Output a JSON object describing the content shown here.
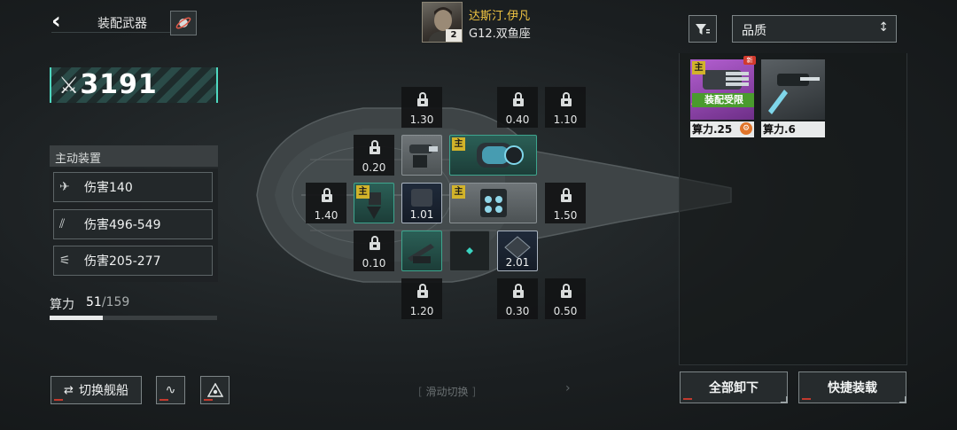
{
  "header": {
    "title": "装配武器",
    "back_icon": "chevron-left-icon",
    "planet_icon": "planet-icon"
  },
  "pilot": {
    "name": "达斯汀.伊凡",
    "level": "2",
    "ship": "G12.双鱼座"
  },
  "power": {
    "value": "3191",
    "icon": "crossed-swords-icon"
  },
  "active_devices": {
    "header": "主动装置",
    "items": [
      {
        "icon": "fighter-squad-icon",
        "label": "伤害140"
      },
      {
        "icon": "claw-strike-icon",
        "label": "伤害496-549"
      },
      {
        "icon": "missile-volley-icon",
        "label": "伤害205-277"
      }
    ]
  },
  "compute": {
    "label": "算力",
    "current": "51",
    "separator": "/",
    "max": "159",
    "fill_fraction": 0.32
  },
  "bottom_left": {
    "switch_label": "切换舰船",
    "switch_icon": "swap-arrows-icon",
    "btn2_icon": "waveform-icon",
    "btn3_icon": "triangle-ship-icon"
  },
  "swipe_hint": "滑动切换",
  "slots": {
    "locked": [
      {
        "id": "r1c2",
        "value": "1.30"
      },
      {
        "id": "r1c4",
        "value": "0.40"
      },
      {
        "id": "r1c5",
        "value": "1.10"
      },
      {
        "id": "r2c1",
        "value": "0.20"
      },
      {
        "id": "r3c0",
        "value": "1.40"
      },
      {
        "id": "r3c5",
        "value": "1.50"
      },
      {
        "id": "r4c1",
        "value": "0.10"
      },
      {
        "id": "r5c2",
        "value": "1.20"
      },
      {
        "id": "r5c4",
        "value": "0.30"
      },
      {
        "id": "r5c5",
        "value": "0.50"
      }
    ],
    "equipped_values": {
      "navy1": "1.01",
      "navy2": "2.01"
    },
    "main_tag": "主"
  },
  "inventory": {
    "sort_label": "品质",
    "filter_icon": "filter-icon",
    "sort_icon": "sort-toggle-icon",
    "cards": [
      {
        "compute_label": "算力.25",
        "main_tag": "主",
        "new_badge": "新",
        "warning": "装配受限",
        "rarity_color": "#8e3fa8"
      },
      {
        "compute_label": "算力.6",
        "rarity_color": "#3c4246"
      }
    ]
  },
  "actions": {
    "unequip_all": "全部卸下",
    "quick_equip": "快捷装载"
  }
}
